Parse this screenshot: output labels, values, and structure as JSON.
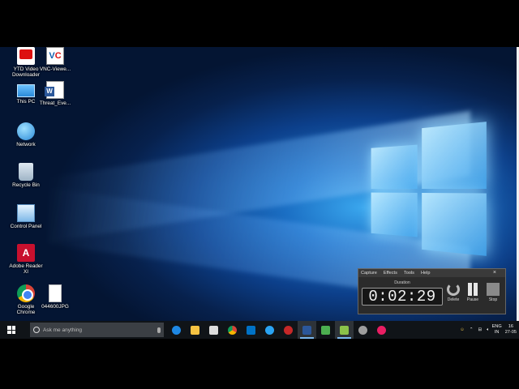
{
  "desktop": {
    "icons": [
      {
        "label": "YTD Video Downloader"
      },
      {
        "label": "VNC-Viewe..."
      },
      {
        "label": "This PC"
      },
      {
        "label": "Threat_Eve..."
      },
      {
        "label": "Network"
      },
      {
        "label": "Recycle Bin"
      },
      {
        "label": "Control Panel"
      },
      {
        "label": "Adobe Reader XI"
      },
      {
        "label": "Google Chrome"
      },
      {
        "label": "044600JPG"
      }
    ]
  },
  "recorder": {
    "menu": [
      "Capture",
      "Effects",
      "Tools",
      "Help"
    ],
    "close": "×",
    "duration_label": "Duration",
    "duration_value": "0:02:29",
    "buttons": {
      "delete": "Delete",
      "pause": "Pause",
      "stop": "Stop"
    }
  },
  "taskbar": {
    "search_placeholder": "Ask me anything",
    "apps": [
      "edge-icon",
      "file-explorer-icon",
      "store-icon",
      "chrome-icon",
      "outlook-icon",
      "ie-icon",
      "snipping-icon",
      "word-icon",
      "camtasia-icon",
      "camtasia-recorder-icon",
      "settings-icon",
      "media-icon"
    ],
    "tray": {
      "lang_top": "ENG",
      "lang_bottom": "IN",
      "time": "16",
      "date": "27-05"
    }
  }
}
